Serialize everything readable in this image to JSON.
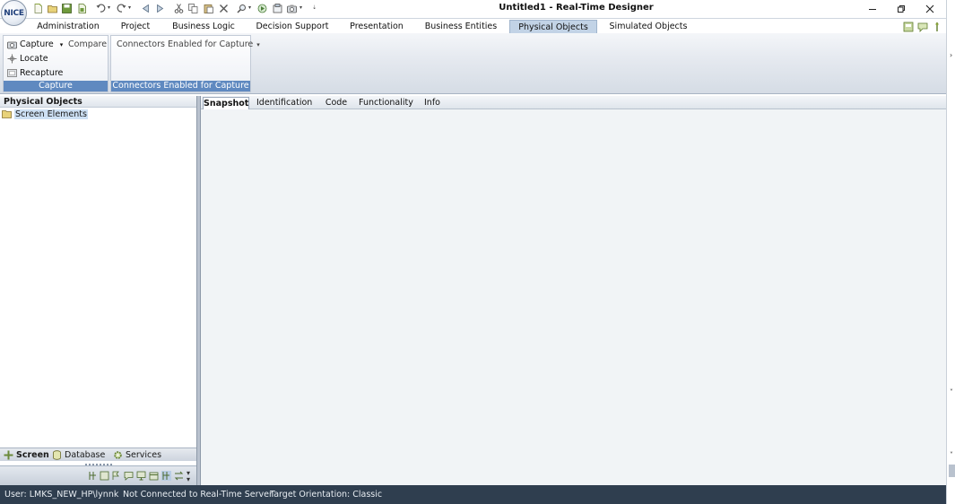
{
  "app": {
    "logo_text": "NICE",
    "window_title": "Untitled1 - Real-Time Designer"
  },
  "menu": {
    "tabs": [
      {
        "label": "Administration"
      },
      {
        "label": "Project"
      },
      {
        "label": "Business Logic"
      },
      {
        "label": "Decision Support"
      },
      {
        "label": "Presentation"
      },
      {
        "label": "Business Entities"
      },
      {
        "label": "Physical Objects",
        "active": true
      },
      {
        "label": "Simulated Objects"
      }
    ]
  },
  "ribbon": {
    "capture_group": {
      "label": "Capture",
      "capture": "Capture",
      "compare": "Compare",
      "locate": "Locate",
      "recapture": "Recapture"
    },
    "connectors_group": {
      "label": "Connectors Enabled for Capture",
      "dropdown": "Connectors Enabled for Capture"
    }
  },
  "left_panel": {
    "title": "Physical Objects",
    "tree": [
      {
        "label": "Screen Elements",
        "selected": true
      }
    ],
    "tabs": [
      {
        "label": "Screen",
        "active": true
      },
      {
        "label": "Database"
      },
      {
        "label": "Services"
      }
    ]
  },
  "right_panel": {
    "tabs": [
      {
        "label": "Snapshot",
        "active": true
      },
      {
        "label": "Identification"
      },
      {
        "label": "Code"
      },
      {
        "label": "Functionality"
      },
      {
        "label": "Info"
      }
    ]
  },
  "status_bar": {
    "user": "User: LMKS_NEW_HP\\lynnk",
    "connection": "Not Connected to Real-Time Server",
    "orientation": "Target Orientation: Classic"
  },
  "colors": {
    "accent": "#5f89c0",
    "active_tab": "#c2d3e6",
    "status_bar": "#2f3e4f",
    "selection": "#cde0f4"
  }
}
